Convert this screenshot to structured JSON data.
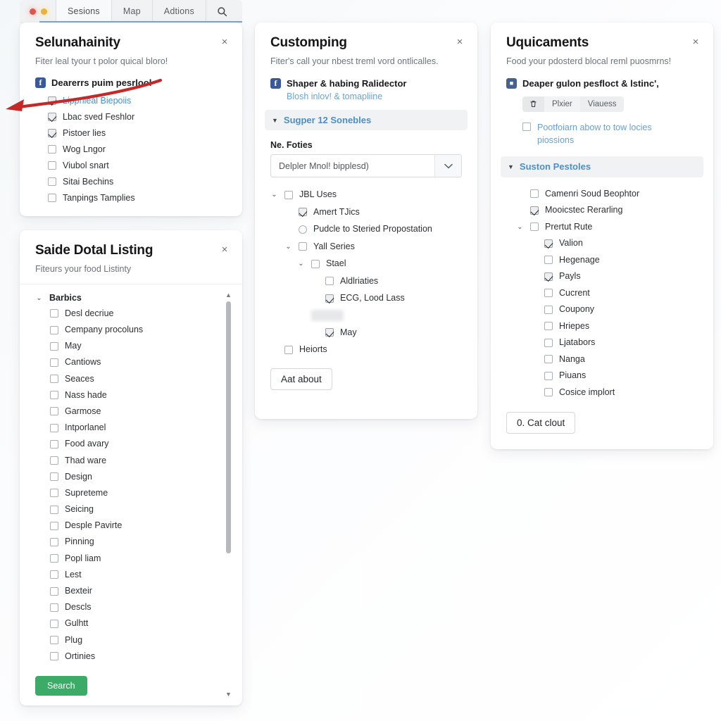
{
  "window": {
    "dots": [
      "close-dot",
      "minimize-dot"
    ],
    "tabs": [
      {
        "label": "Sesions",
        "active": true
      },
      {
        "label": "Map",
        "active": false
      },
      {
        "label": "Adtions",
        "active": false
      }
    ],
    "search_icon": "search-icon"
  },
  "colors": {
    "accent_blue": "#4d8fc4",
    "brand_blue": "#3b5998",
    "primary_green": "#3cab68",
    "annotation_red": "#c62828"
  },
  "annotation": {
    "shape": "curved-arrow",
    "color": "#c62828"
  },
  "panel1": {
    "title": "Selunahainity",
    "subtitle": "Fiter leal tyour t polor quical bloro!",
    "close": "×",
    "group": {
      "icon": "facebook-icon",
      "icon_glyph": "f",
      "label": "Dearerrs puim pesrlool"
    },
    "items": [
      {
        "label": "Lippnieal Biepoiis",
        "checked": true,
        "blue": true
      },
      {
        "label": "Lbac sved Feshlor",
        "checked": true,
        "blue": false
      },
      {
        "label": "Pistoer lies",
        "checked": true,
        "blue": false
      },
      {
        "label": "Wog Lngor",
        "checked": false,
        "blue": false
      },
      {
        "label": "Viubol snart",
        "checked": false,
        "blue": false
      },
      {
        "label": "Sitai Bechins",
        "checked": false,
        "blue": false
      },
      {
        "label": "Tanpings Tamplies",
        "checked": false,
        "blue": false
      }
    ]
  },
  "panel2": {
    "title": "Saide Dotal Listing",
    "subtitle": "Fiteurs your food Listinty",
    "close": "×",
    "group_caret": "⌄",
    "group_label": "Barbics",
    "items": [
      "Desl decriue",
      "Cempany procoluns",
      "May",
      "Cantiows",
      "Seaces",
      "Nass hade",
      "Garmose",
      "Intporlanel",
      "Food avary",
      "Thad ware",
      "Design",
      "Supreteme",
      "Seicing",
      "Desple Pavirte",
      "Pinning",
      "Popl liam",
      "Lest",
      "Bexteir",
      "Descls",
      "Gulhtt",
      "Plug",
      "Ortinies"
    ],
    "scroll_up": "▲",
    "scroll_down": "▼",
    "search_button": "Search"
  },
  "panel3": {
    "title": "Customping",
    "subtitle": "Fiter's call your nbest treml vord ontlicalles.",
    "close": "×",
    "group": {
      "icon": "facebook-icon",
      "icon_glyph": "f",
      "label": "Shaper & habing Ralidector"
    },
    "sublink": "Blosh inlov! & tomapliine",
    "highlight": {
      "caret": "▼",
      "label": "Sugper 12 Sonebles"
    },
    "field_label": "Ne. Foties",
    "select": {
      "value": "Delpler Mnol! bipplesd)",
      "chevron": "chevron-down-icon"
    },
    "tree": [
      {
        "indent": 0,
        "caret": "⌄",
        "control": "checkbox",
        "checked": false,
        "label": "JBL Uses"
      },
      {
        "indent": 1,
        "caret": "",
        "control": "checkbox",
        "checked": true,
        "label": "Amert TJics"
      },
      {
        "indent": 1,
        "caret": "",
        "control": "radio",
        "checked": false,
        "label": "Pudcle to Steried Propostation"
      },
      {
        "indent": 1,
        "caret": "⌄",
        "control": "checkbox",
        "checked": false,
        "label": "Yall Series"
      },
      {
        "indent": 2,
        "caret": "⌄",
        "control": "checkbox",
        "checked": false,
        "label": "Stael"
      },
      {
        "indent": 3,
        "caret": "",
        "control": "checkbox",
        "checked": false,
        "label": "Aldlriaties"
      },
      {
        "indent": 3,
        "caret": "",
        "control": "checkbox",
        "checked": true,
        "label": "ECG, Lood Lass"
      },
      {
        "indent": 3,
        "caret": "",
        "control": "redacted",
        "checked": false,
        "label": ""
      },
      {
        "indent": 3,
        "caret": "",
        "control": "checkbox",
        "checked": true,
        "label": "May"
      },
      {
        "indent": 0,
        "caret": "",
        "control": "checkbox",
        "checked": false,
        "label": "Heiorts"
      }
    ],
    "footer_button": "Aat about"
  },
  "panel4": {
    "title": "Uquicaments",
    "subtitle": "Food your pdosterd blocal reml puosmrns!",
    "close": "×",
    "group": {
      "icon": "app-icon",
      "icon_glyph": "■",
      "label": "Deaper gulon pesfloct & lstinc',"
    },
    "segmented": [
      {
        "label": "",
        "icon": "trash-icon",
        "selected": true
      },
      {
        "label": "Plxier",
        "selected": false
      },
      {
        "label": "Viauess",
        "selected": false
      }
    ],
    "note": {
      "checked": false,
      "label": "Pootfoiarn abow to tow locies piossions"
    },
    "highlight": {
      "caret": "▼",
      "label": "Suston Pestoles"
    },
    "items": [
      {
        "indent": 0,
        "caret": "",
        "checked": false,
        "label": "Camenri Soud Beophtor"
      },
      {
        "indent": 0,
        "caret": "",
        "checked": true,
        "label": "Mooicstec Rerarling"
      },
      {
        "indent": 0,
        "caret": "⌄",
        "checked": false,
        "label": "Prertut Rute"
      },
      {
        "indent": 1,
        "caret": "",
        "checked": true,
        "label": "Valion"
      },
      {
        "indent": 1,
        "caret": "",
        "checked": false,
        "label": "Hegenage"
      },
      {
        "indent": 1,
        "caret": "",
        "checked": true,
        "label": "Payls"
      },
      {
        "indent": 1,
        "caret": "",
        "checked": false,
        "label": "Cucrent"
      },
      {
        "indent": 1,
        "caret": "",
        "checked": false,
        "label": "Coupony"
      },
      {
        "indent": 1,
        "caret": "",
        "checked": false,
        "label": "Hriepes"
      },
      {
        "indent": 1,
        "caret": "",
        "checked": false,
        "label": "Ljatabors"
      },
      {
        "indent": 1,
        "caret": "",
        "checked": false,
        "label": "Nanga"
      },
      {
        "indent": 1,
        "caret": "",
        "checked": false,
        "label": "Piuans"
      },
      {
        "indent": 1,
        "caret": "",
        "checked": false,
        "label": "Cosice implort"
      }
    ],
    "footer_button": "0. Cat clout"
  }
}
